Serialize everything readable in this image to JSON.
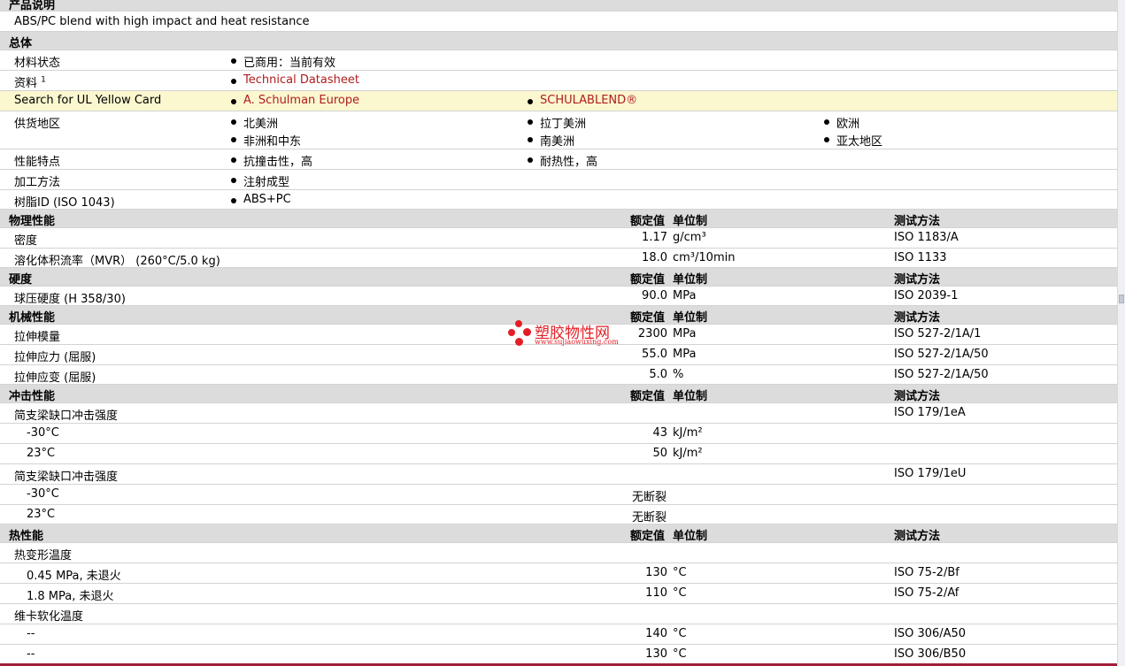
{
  "product_desc": {
    "heading": "产品说明",
    "text": "ABS/PC blend with high impact and heat resistance"
  },
  "general": {
    "heading": "总体",
    "material_status_label": "材料状态",
    "material_status_value": "已商用：当前有效",
    "resources_label": "资料",
    "resources_sup": "1",
    "resources_link": "Technical Datasheet",
    "ul_label": "Search for UL Yellow Card",
    "ul_link1": "A. Schulman Europe",
    "ul_link2": "SCHULABLEND®",
    "supply_label": "供货地区",
    "supply": [
      "北美洲",
      "拉丁美洲",
      "欧洲",
      "非洲和中东",
      "南美洲",
      "亚太地区"
    ],
    "features_label": "性能特点",
    "features": [
      "抗撞击性，高",
      "耐热性，高"
    ],
    "process_label": "加工方法",
    "process_value": "注射成型",
    "resin_label": "树脂ID (ISO 1043)",
    "resin_value": "ABS+PC"
  },
  "columns": {
    "value": "额定值",
    "unit": "单位制",
    "method": "测试方法"
  },
  "physical": {
    "heading": "物理性能",
    "rows": [
      {
        "name": "密度",
        "value": "1.17",
        "unit": "g/cm³",
        "method": "ISO 1183/A"
      },
      {
        "name": "溶化体积流率（MVR） (260°C/5.0 kg)",
        "value": "18.0",
        "unit": "cm³/10min",
        "method": "ISO 1133"
      }
    ]
  },
  "hardness": {
    "heading": "硬度",
    "rows": [
      {
        "name": "球压硬度  (H 358/30)",
        "value": "90.0",
        "unit": "MPa",
        "method": "ISO 2039-1"
      }
    ]
  },
  "mechanical": {
    "heading": "机械性能",
    "rows": [
      {
        "name": "拉伸模量",
        "value": "2300",
        "unit": "MPa",
        "method": "ISO 527-2/1A/1"
      },
      {
        "name": "拉伸应力  (屈服)",
        "value": "55.0",
        "unit": "MPa",
        "method": "ISO 527-2/1A/50"
      },
      {
        "name": "拉伸应变  (屈服)",
        "value": "5.0",
        "unit": "%",
        "method": "ISO 527-2/1A/50"
      }
    ]
  },
  "impact": {
    "heading": "冲击性能",
    "group1_name": "简支梁缺口冲击强度",
    "group1_method": "ISO 179/1eA",
    "group1_rows": [
      {
        "name": "-30°C",
        "value": "43",
        "unit": "kJ/m²"
      },
      {
        "name": "23°C",
        "value": "50",
        "unit": "kJ/m²"
      }
    ],
    "group2_name": "简支梁缺口冲击强度",
    "group2_method": "ISO 179/1eU",
    "group2_rows": [
      {
        "name": "-30°C",
        "value": "无断裂"
      },
      {
        "name": "23°C",
        "value": "无断裂"
      }
    ]
  },
  "thermal": {
    "heading": "热性能",
    "group1_name": "热变形温度",
    "group1_rows": [
      {
        "name": "0.45 MPa, 未退火",
        "value": "130",
        "unit": "°C",
        "method": "ISO 75-2/Bf"
      },
      {
        "name": "1.8 MPa, 未退火",
        "value": "110",
        "unit": "°C",
        "method": "ISO 75-2/Af"
      }
    ],
    "group2_name": "维卡软化温度",
    "group2_rows": [
      {
        "name": "--",
        "value": "140",
        "unit": "°C",
        "method": "ISO 306/A50"
      },
      {
        "name": "--",
        "value": "130",
        "unit": "°C",
        "method": "ISO 306/B50"
      }
    ]
  },
  "watermark": {
    "text": "塑胶物性网",
    "url": "www.sujiaowuxing.com"
  },
  "colors": {
    "link": "#b01c1c",
    "header_bg": "#dcdcdc",
    "highlight_bg": "#fbf7cf",
    "watermark": "#e41e26"
  }
}
